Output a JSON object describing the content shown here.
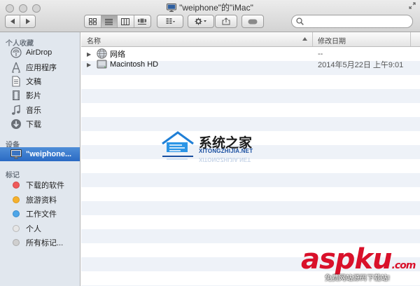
{
  "window": {
    "title": "\"weiphone\"的\"iMac\""
  },
  "search": {
    "placeholder": ""
  },
  "sidebar": {
    "sections": [
      {
        "header": "个人收藏",
        "items": [
          {
            "label": "AirDrop",
            "icon": "airdrop-icon"
          },
          {
            "label": "应用程序",
            "icon": "applications-icon"
          },
          {
            "label": "文稿",
            "icon": "documents-icon"
          },
          {
            "label": "影片",
            "icon": "movies-icon"
          },
          {
            "label": "音乐",
            "icon": "music-icon"
          },
          {
            "label": "下载",
            "icon": "downloads-icon"
          }
        ]
      },
      {
        "header": "设备",
        "items": [
          {
            "label": "\"weiphone...",
            "icon": "imac-icon",
            "selected": true
          }
        ]
      },
      {
        "header": "标记",
        "items": [
          {
            "label": "下载的软件",
            "color": "#ef5a5a"
          },
          {
            "label": "旅游资料",
            "color": "#f5b12e"
          },
          {
            "label": "工作文件",
            "color": "#4ea6e8"
          },
          {
            "label": "个人",
            "color": "#e0e0e0"
          },
          {
            "label": "所有标记...",
            "color": "#c9c9c9"
          }
        ]
      }
    ]
  },
  "list": {
    "columns": {
      "name": "名称",
      "date": "修改日期"
    },
    "rows": [
      {
        "name": "网络",
        "date": "--",
        "icon": "network-globe-icon"
      },
      {
        "name": "Macintosh HD",
        "date": "2014年5月22日 上午9:01",
        "icon": "hard-drive-icon"
      }
    ]
  },
  "watermarks": {
    "site1": {
      "name": "系统之家",
      "url": "XITONGZHIJIA.NET"
    },
    "site2": {
      "brand": "aspku",
      "domain": ".com",
      "tagline": "免费网站源码下载站!"
    }
  },
  "colors": {
    "selection": "#2f6fc8",
    "watermark_red": "#d9102a",
    "watermark_blue": "#1a4fa0"
  }
}
